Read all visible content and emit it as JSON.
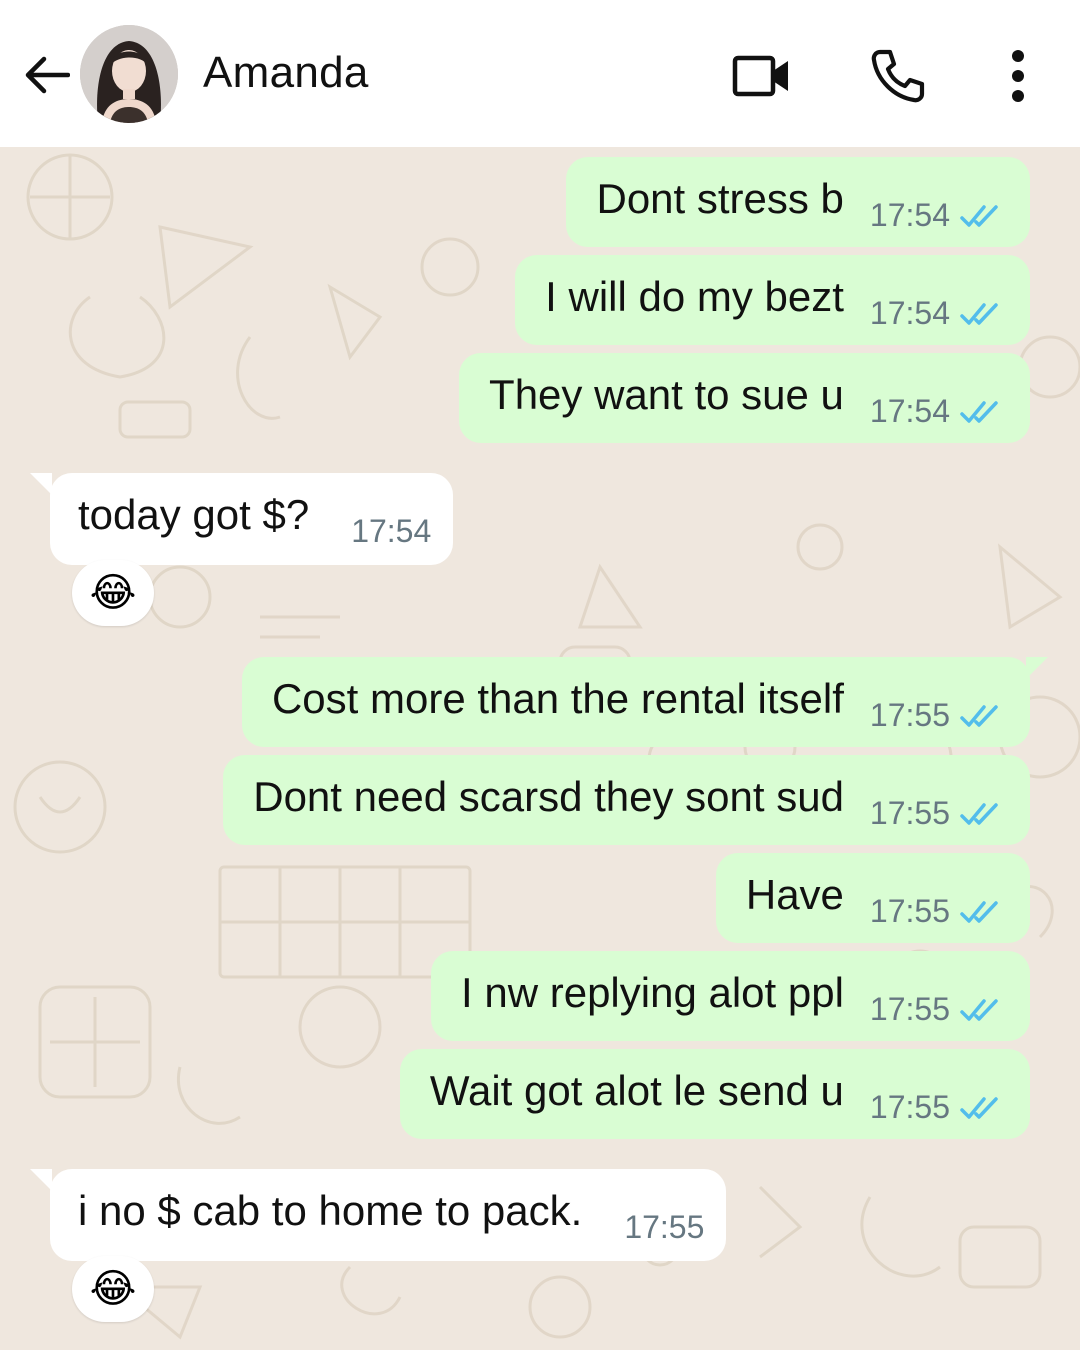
{
  "header": {
    "contact_name": "Amanda"
  },
  "messages": [
    {
      "text": "Dont stress b",
      "time": "17:54",
      "direction": "out"
    },
    {
      "text": "I will do my bezt",
      "time": "17:54",
      "direction": "out"
    },
    {
      "text": "They want to sue u",
      "time": "17:54",
      "direction": "out"
    },
    {
      "text": "today got $?",
      "time": "17:54",
      "direction": "in",
      "reaction": "😂"
    },
    {
      "text": "Cost more than the rental itself",
      "time": "17:55",
      "direction": "out"
    },
    {
      "text": "Dont need scarsd they sont sud",
      "time": "17:55",
      "direction": "out"
    },
    {
      "text": "Have",
      "time": "17:55",
      "direction": "out"
    },
    {
      "text": "I nw replying alot ppl",
      "time": "17:55",
      "direction": "out"
    },
    {
      "text": "Wait got alot le send u",
      "time": "17:55",
      "direction": "out"
    },
    {
      "text": "i no $ cab to home to pack.",
      "time": "17:55",
      "direction": "in",
      "reaction": "😂"
    }
  ],
  "colors": {
    "outgoing_bubble": "#d9fdd3",
    "incoming_bubble": "#ffffff",
    "chat_background": "#efe7de",
    "read_ticks": "#53bdeb"
  }
}
